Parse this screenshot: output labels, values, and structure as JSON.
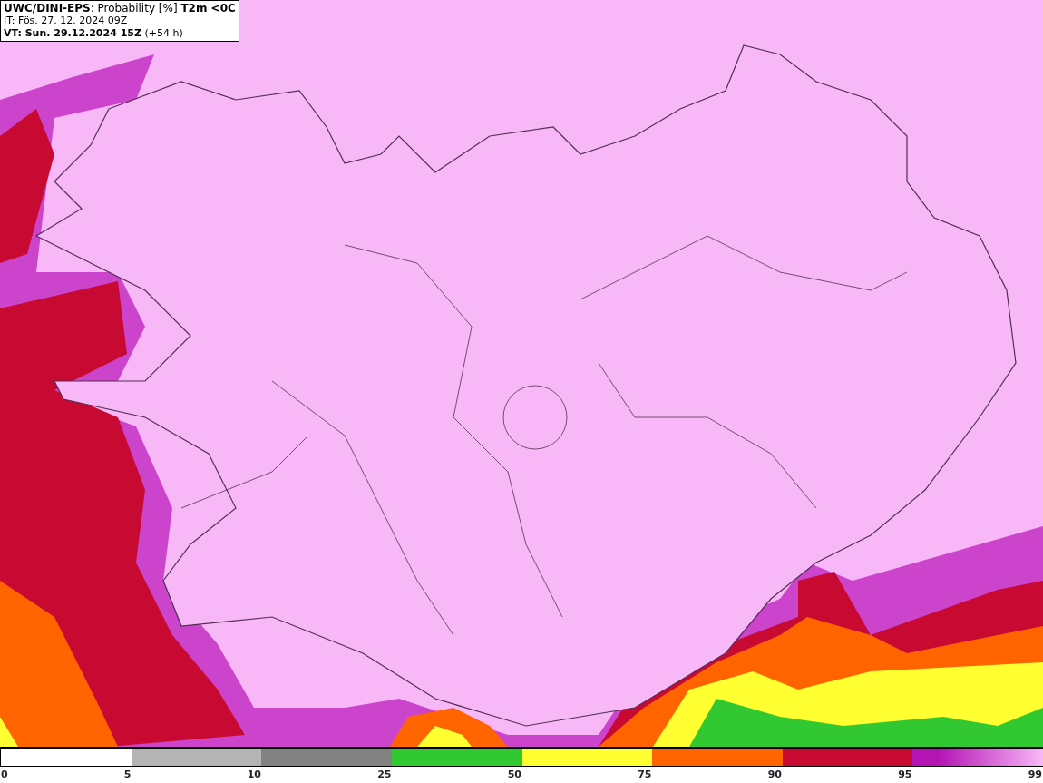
{
  "header": {
    "lines": [
      "**UWC/DINI-EPS**: Probability [%] **T2m <0C**",
      "IT: Fös. 27. 12. 2024 09Z",
      "**VT: Sun. 29.12.2024 15Z** (+54 h)"
    ]
  },
  "legend": {
    "segments": [
      {
        "color": "#ffffff"
      },
      {
        "color": "#b4b4b4"
      },
      {
        "color": "#828282"
      },
      {
        "color": "#32c832"
      },
      {
        "color": "#ffff32"
      },
      {
        "color": "#ff6400"
      },
      {
        "color": "#c80a32"
      },
      {
        "color": "#b414b4"
      }
    ],
    "labels": [
      "0",
      "5",
      "10",
      "25",
      "50",
      "75",
      "90",
      "95",
      "99"
    ]
  }
}
